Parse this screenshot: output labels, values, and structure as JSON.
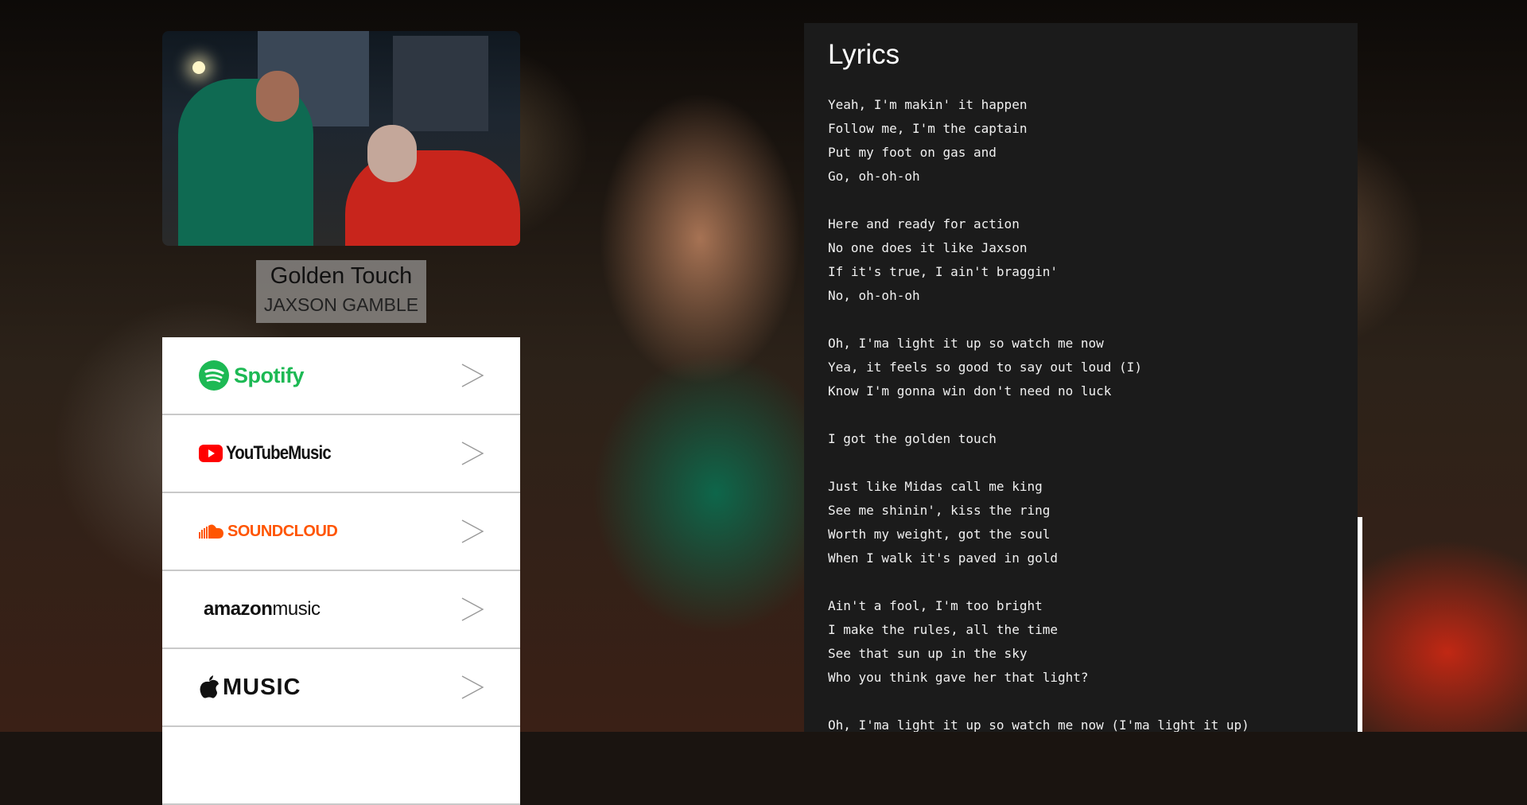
{
  "song": {
    "title": "Golden Touch",
    "artist": "JAXSON GAMBLE"
  },
  "platforms": [
    {
      "name": "Spotify",
      "icon": "spotify-logo"
    },
    {
      "name": "YouTube Music",
      "wordmark": "YouTubeMusic",
      "icon": "youtube-music-logo"
    },
    {
      "name": "SoundCloud",
      "wordmark": "SOUNDCLOUD",
      "icon": "soundcloud-logo"
    },
    {
      "name": "Amazon Music",
      "wordmark_a": "amazon",
      "wordmark_b": "music",
      "icon": "amazon-music-logo"
    },
    {
      "name": "Apple Music",
      "wordmark": "MUSIC",
      "icon": "apple-music-logo"
    }
  ],
  "lyrics": {
    "heading": "Lyrics",
    "lines": [
      "Yeah, I'm makin' it happen",
      "Follow me, I'm the captain",
      "Put my foot on gas and",
      "Go, oh-oh-oh",
      "",
      "Here and ready for action",
      "No one does it like Jaxson",
      "If it's true, I ain't braggin'",
      "No, oh-oh-oh",
      "",
      "Oh, I'ma light it up so watch me now",
      "Yea, it feels so good to say out loud (I)",
      "Know I'm gonna win don't need no luck",
      "",
      "I got the golden touch",
      "",
      "Just like Midas call me king",
      "See me shinin', kiss the ring",
      "Worth my weight, got the soul",
      "When I walk it's paved in gold",
      "",
      "Ain't a fool, I'm too bright",
      "I make the rules, all the time",
      "See that sun up in the sky",
      "Who you think gave her that light?",
      "",
      "Oh, I'ma light it up so watch me now (I'ma light it up)"
    ]
  },
  "colors": {
    "spotify": "#1db954",
    "youtube": "#ff0000",
    "soundcloud": "#ff5500",
    "lyrics_bg": "#1b1b1b"
  }
}
